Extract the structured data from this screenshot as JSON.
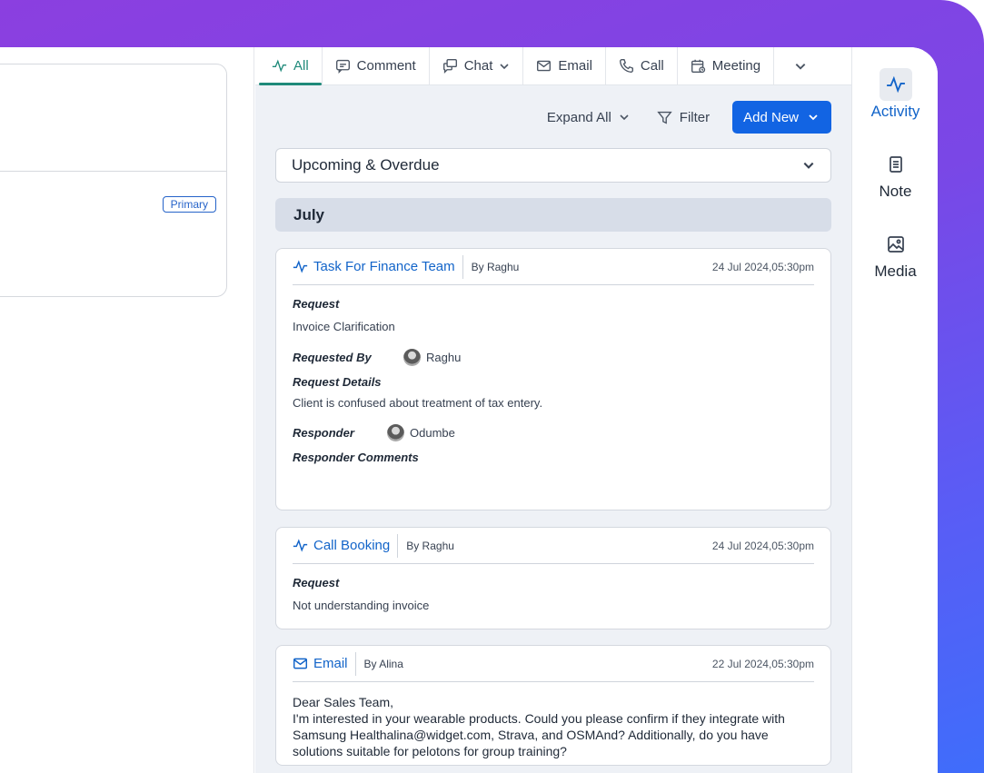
{
  "tabs": [
    {
      "label": "All",
      "icon": "activity-icon",
      "active": true
    },
    {
      "label": "Comment",
      "icon": "comment-icon"
    },
    {
      "label": "Chat",
      "icon": "chat-icon",
      "dropdown": true
    },
    {
      "label": "Email",
      "icon": "mail-icon"
    },
    {
      "label": "Call",
      "icon": "phone-icon"
    },
    {
      "label": "Meeting",
      "icon": "calendar-icon"
    }
  ],
  "left": {
    "primary_badge": "Primary"
  },
  "toolbar": {
    "expand_all": "Expand All",
    "filter": "Filter",
    "add_new": "Add New"
  },
  "filter_select": {
    "value": "Upcoming & Overdue"
  },
  "month_header": "July",
  "cards": [
    {
      "title": "Task For Finance Team",
      "by": "By Raghu",
      "date": "24 Jul 2024,05:30pm",
      "request_label": "Request",
      "request_value": "Invoice Clarification",
      "requested_by_label": "Requested By",
      "requested_by": "Raghu",
      "details_label": "Request Details",
      "details_value": "Client is confused about treatment of tax entery.",
      "responder_label": "Responder",
      "responder": "Odumbe",
      "responder_comments_label": "Responder Comments"
    },
    {
      "title": "Call Booking",
      "by": "By Raghu",
      "date": "24 Jul 2024,05:30pm",
      "request_label": "Request",
      "request_value": "Not understanding invoice"
    },
    {
      "title": "Email",
      "by": "By Alina",
      "date": "22 Jul 2024,05:30pm",
      "body_line1": "Dear Sales Team,",
      "body_line2": "I'm interested in your wearable products. Could you please confirm if they integrate with Samsung Healthalina@widget.com, Strava, and OSMAnd? Additionally, do you have solutions suitable for pelotons for group training?"
    }
  ],
  "rail": [
    {
      "label": "Activity",
      "icon": "activity-icon",
      "active": true
    },
    {
      "label": "Note",
      "icon": "note-icon"
    },
    {
      "label": "Media",
      "icon": "image-icon"
    }
  ],
  "colors": {
    "accent_teal": "#1f8a7a",
    "primary_blue": "#1264e3",
    "link_blue": "#1264c9"
  }
}
